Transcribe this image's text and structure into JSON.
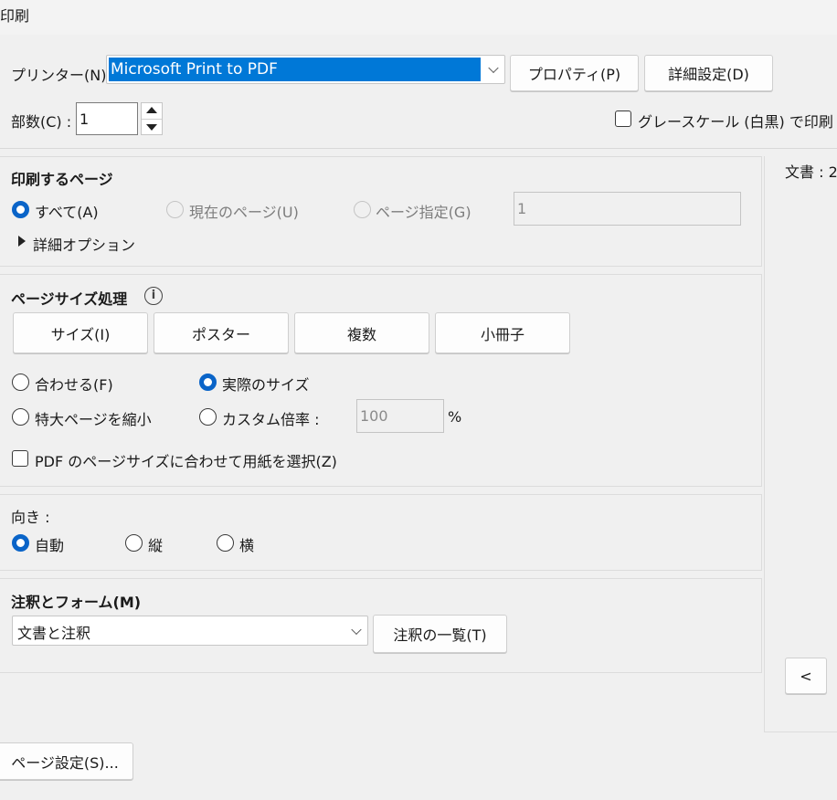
{
  "window": {
    "title": "印刷"
  },
  "printer": {
    "label": "プリンター(N) :",
    "selected": "Microsoft Print to PDF",
    "properties_button": "プロパティ(P)",
    "advanced_button": "詳細設定(D)"
  },
  "copies": {
    "label": "部数(C) :",
    "value": "1"
  },
  "grayscale": {
    "label": "グレースケール (白黒) で印刷"
  },
  "pages": {
    "heading": "印刷するページ",
    "all": "すべて(A)",
    "current": "現在のページ(U)",
    "range": "ページ指定(G)",
    "range_value": "1",
    "more_options": "詳細オプション"
  },
  "page_sizing": {
    "heading": "ページサイズ処理",
    "tabs": [
      "サイズ(I)",
      "ポスター",
      "複数",
      "小冊子"
    ],
    "fit": "合わせる(F)",
    "actual_size": "実際のサイズ",
    "shrink": "特大ページを縮小",
    "custom_scale": "カスタム倍率 :",
    "scale_value": "100",
    "percent": "%",
    "choose_paper": "PDF のページサイズに合わせて用紙を選択(Z)"
  },
  "orientation": {
    "heading": "向き :",
    "auto": "自動",
    "portrait": "縦",
    "landscape": "横"
  },
  "annotations": {
    "heading": "注釈とフォーム(M)",
    "selected": "文書と注釈",
    "summary_button": "注釈の一覧(T)"
  },
  "preview": {
    "label": "文書 : 2",
    "prev_button": "<"
  },
  "page_setup_button": "ページ設定(S)...",
  "colors": {
    "accent": "#0a64c8",
    "selection": "#0078d7"
  }
}
